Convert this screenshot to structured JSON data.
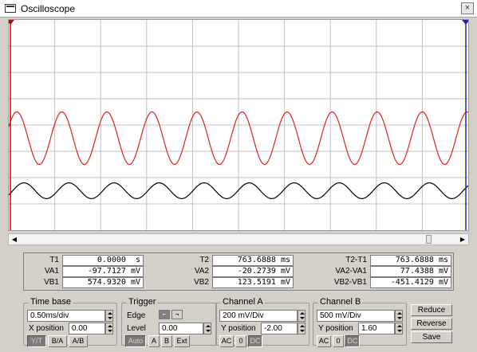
{
  "window": {
    "title": "Oscilloscope",
    "close_glyph": "×"
  },
  "scope": {
    "colors": {
      "channel_a": "#e02020",
      "channel_b": "#000000",
      "grid": "#c0c0c0",
      "cursor1": "#cc0000",
      "cursor2": "#2020c0"
    },
    "traces": {
      "channel_a": {
        "cycles": 10.2,
        "amplitude_divs": 1.0,
        "offset_divs": -0.5
      },
      "channel_b": {
        "cycles": 10.2,
        "amplitude_divs": 0.3,
        "offset_divs": -2.5
      }
    },
    "grid_divs": {
      "x": 10,
      "y": 8
    }
  },
  "readouts": {
    "group1": [
      {
        "label": "T1",
        "value": "0.0000  s"
      },
      {
        "label": "VA1",
        "value": "-97.7127 mV"
      },
      {
        "label": "VB1",
        "value": "574.9320 mV"
      }
    ],
    "group2": [
      {
        "label": "T2",
        "value": "763.6888 ms"
      },
      {
        "label": "VA2",
        "value": "-20.2739 mV"
      },
      {
        "label": "VB2",
        "value": "123.5191 mV"
      }
    ],
    "group3": [
      {
        "label": "T2-T1",
        "value": "763.6888 ms"
      },
      {
        "label": "VA2-VA1",
        "value": "77.4388 mV"
      },
      {
        "label": "VB2-VB1",
        "value": "-451.4129 mV"
      }
    ]
  },
  "timebase": {
    "title": "Time base",
    "value": "0.50ms/div",
    "xpos_label": "X position",
    "xpos_value": "0.00",
    "modes": [
      "Y/T",
      "B/A",
      "A/B"
    ]
  },
  "trigger": {
    "title": "Trigger",
    "edge_label": "Edge",
    "level_label": "Level",
    "level_value": "0.00",
    "sources": [
      "Auto",
      "A",
      "B",
      "Ext"
    ]
  },
  "channel_a": {
    "title": "Channel A",
    "scale": "200 mV/Div",
    "ypos_label": "Y position",
    "ypos_value": "-2.00",
    "coupling": [
      "AC",
      "0",
      "DC"
    ]
  },
  "channel_b": {
    "title": "Channel B",
    "scale": "500 mV/Div",
    "ypos_label": "Y position",
    "ypos_value": "1.60",
    "coupling": [
      "AC",
      "0",
      "DC"
    ]
  },
  "actions": {
    "reduce": "Reduce",
    "reverse": "Reverse",
    "save": "Save"
  }
}
